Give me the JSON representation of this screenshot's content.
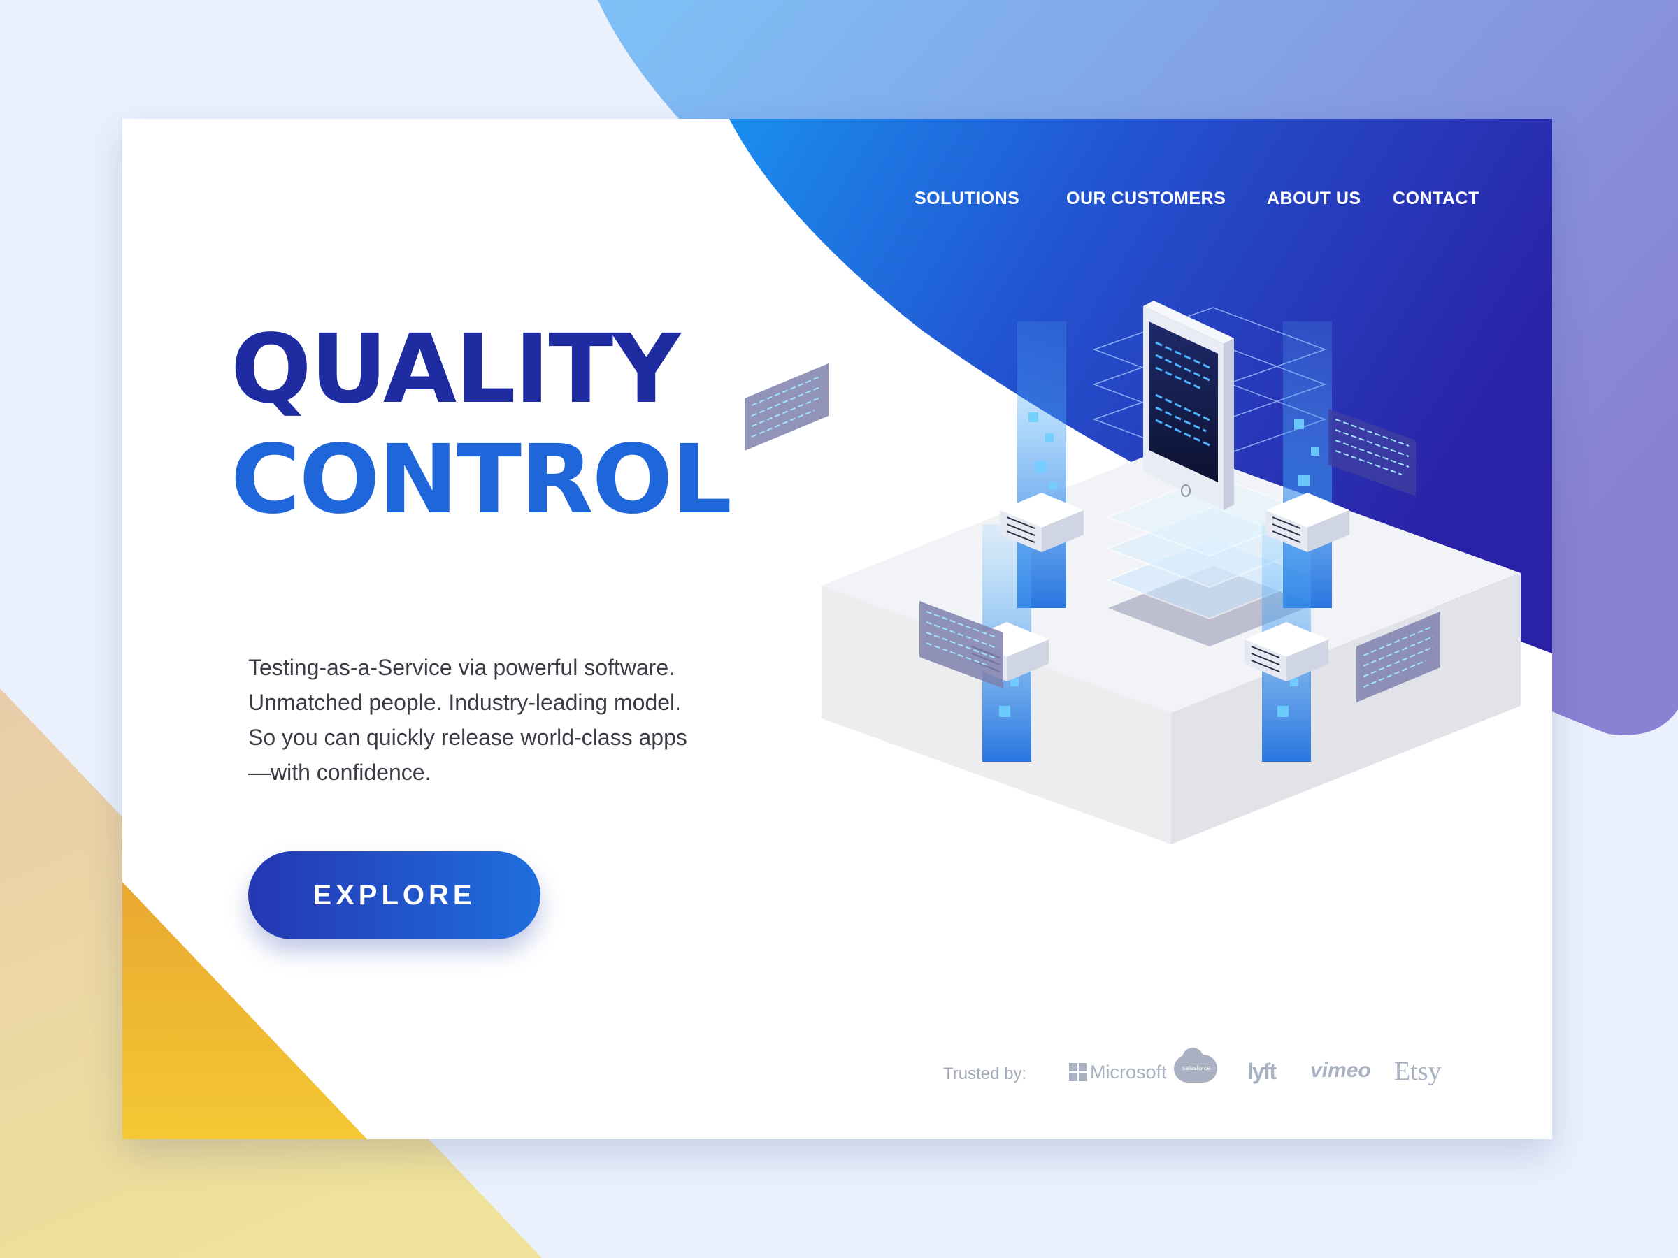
{
  "nav": {
    "items": [
      {
        "label": "SOLUTIONS"
      },
      {
        "label": "OUR CUSTOMERS"
      },
      {
        "label": "ABOUT US"
      },
      {
        "label": "CONTACT"
      }
    ]
  },
  "hero": {
    "title_line1": "QUALITY",
    "title_line2": "CONTROL",
    "description": [
      "Testing-as-a-Service via powerful software.",
      "Unmatched people. Industry-leading model.",
      "So you can quickly release world-class apps",
      "—with confidence."
    ],
    "cta_label": "EXPLORE"
  },
  "trusted": {
    "label": "Trusted by:",
    "logos": [
      {
        "name": "Microsoft",
        "text": "Microsoft"
      },
      {
        "name": "salesforce",
        "text": "salesforce"
      },
      {
        "name": "lyft",
        "text": "lyft"
      },
      {
        "name": "vimeo",
        "text": "vimeo"
      },
      {
        "name": "Etsy",
        "text": "Etsy"
      }
    ]
  },
  "colors": {
    "page_background": "#eaf1fd",
    "title_dark_blue": "#1f2ba0",
    "title_light_blue": "#1e66da",
    "nav_text": "#ffffff",
    "accent_gradient_start": "#1a8ef0",
    "accent_gradient_end": "#2a22a6",
    "yellow_accent": "#f0c230"
  },
  "illustration": {
    "name": "isometric-server-platform",
    "icons": [
      "smartphone-icon",
      "server-rack-icon",
      "code-panel-icon"
    ]
  }
}
